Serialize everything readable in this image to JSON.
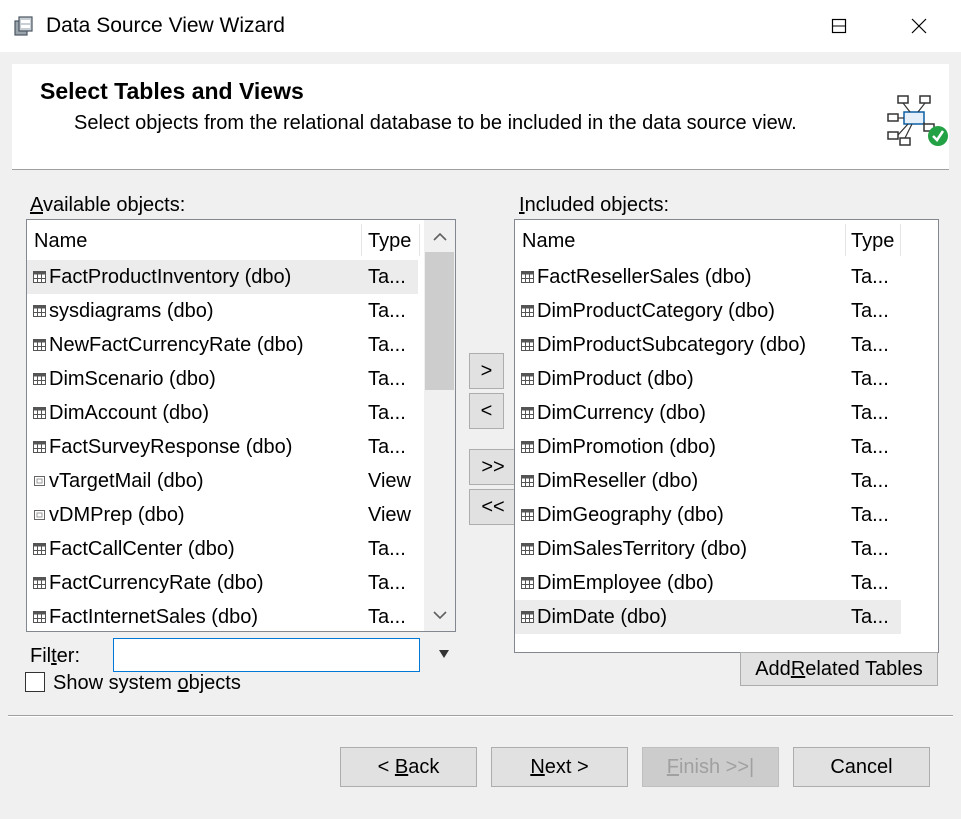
{
  "window": {
    "title": "Data Source View Wizard",
    "app_icon": "database-wizard-icon",
    "minimize_icon": "minimize-icon",
    "maximize_icon": "maximize-icon",
    "close_icon": "close-icon"
  },
  "header": {
    "title": "Select Tables and Views",
    "subtitle": "Select objects from the relational database to be included in the data source view.",
    "icon": "data-source-view-check-icon"
  },
  "available": {
    "label_accel": "A",
    "label_rest": "vailable objects:",
    "col_name": "Name",
    "col_type": "Type",
    "rows": [
      {
        "name": "FactProductInventory (dbo)",
        "type": "Ta...",
        "icon": "table-icon",
        "selected": true
      },
      {
        "name": "sysdiagrams (dbo)",
        "type": "Ta...",
        "icon": "table-icon"
      },
      {
        "name": "NewFactCurrencyRate (dbo)",
        "type": "Ta...",
        "icon": "table-icon"
      },
      {
        "name": "DimScenario (dbo)",
        "type": "Ta...",
        "icon": "table-icon"
      },
      {
        "name": "DimAccount (dbo)",
        "type": "Ta...",
        "icon": "table-icon"
      },
      {
        "name": "FactSurveyResponse (dbo)",
        "type": "Ta...",
        "icon": "table-icon"
      },
      {
        "name": "vTargetMail (dbo)",
        "type": "View",
        "icon": "view-icon"
      },
      {
        "name": "vDMPrep (dbo)",
        "type": "View",
        "icon": "view-icon"
      },
      {
        "name": "FactCallCenter (dbo)",
        "type": "Ta...",
        "icon": "table-icon"
      },
      {
        "name": "FactCurrencyRate (dbo)",
        "type": "Ta...",
        "icon": "table-icon"
      },
      {
        "name": "FactInternetSales (dbo)",
        "type": "Ta...",
        "icon": "table-icon"
      }
    ]
  },
  "included": {
    "label_accel": "I",
    "label_rest": "ncluded objects:",
    "col_name": "Name",
    "col_type": "Type",
    "rows": [
      {
        "name": "FactResellerSales (dbo)",
        "type": "Ta...",
        "icon": "table-icon"
      },
      {
        "name": "DimProductCategory (dbo)",
        "type": "Ta...",
        "icon": "table-icon"
      },
      {
        "name": "DimProductSubcategory (dbo)",
        "type": "Ta...",
        "icon": "table-icon"
      },
      {
        "name": "DimProduct (dbo)",
        "type": "Ta...",
        "icon": "table-icon"
      },
      {
        "name": "DimCurrency (dbo)",
        "type": "Ta...",
        "icon": "table-icon"
      },
      {
        "name": "DimPromotion (dbo)",
        "type": "Ta...",
        "icon": "table-icon"
      },
      {
        "name": "DimReseller (dbo)",
        "type": "Ta...",
        "icon": "table-icon"
      },
      {
        "name": "DimGeography (dbo)",
        "type": "Ta...",
        "icon": "table-icon"
      },
      {
        "name": "DimSalesTerritory (dbo)",
        "type": "Ta...",
        "icon": "table-icon"
      },
      {
        "name": "DimEmployee (dbo)",
        "type": "Ta...",
        "icon": "table-icon"
      },
      {
        "name": "DimDate (dbo)",
        "type": "Ta...",
        "icon": "table-icon",
        "selected": true
      }
    ]
  },
  "transfer": {
    "add": ">",
    "remove": "<",
    "add_all": ">>",
    "remove_all": "<<"
  },
  "filter": {
    "label_pre": "Fil",
    "label_accel": "t",
    "label_post": "er:",
    "value": "",
    "dropdown_icon": "filter-dropdown-icon"
  },
  "show_system": {
    "label_pre": "Show system ",
    "label_accel": "o",
    "label_post": "bjects",
    "checked": false
  },
  "add_related": {
    "pre": "Add ",
    "accel": "R",
    "post": "elated Tables"
  },
  "footer": {
    "back_pre": "< ",
    "back_accel": "B",
    "back_post": "ack",
    "next_accel": "N",
    "next_post": "ext >",
    "finish_accel": "F",
    "finish_post": "inish >>|",
    "cancel": "Cancel"
  }
}
